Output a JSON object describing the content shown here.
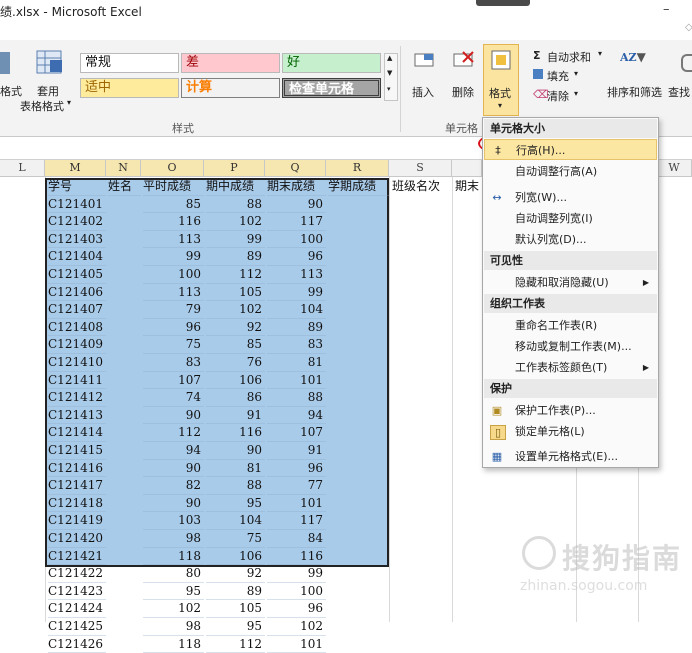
{
  "titlebar": {
    "title": "绩.xlsx - Microsoft Excel",
    "minimize_glyph": "–",
    "help_glyph": "⌂"
  },
  "ribbon": {
    "left_partial_label": "格式",
    "table_format_label1": "套用",
    "table_format_label2": "表格格式",
    "styles": {
      "normal": "常规",
      "bad": "差",
      "good": "好",
      "neutral": "适中",
      "calc": "计算",
      "check": "检查单元格",
      "group_label": "样式"
    },
    "cells": {
      "insert": "插入",
      "delete": "删除",
      "format": "格式",
      "group_label": "单元格"
    },
    "editing": {
      "autosum": "自动求和",
      "fill": "填充",
      "clear": "清除",
      "sort_filter": "排序和筛选",
      "find": "查找"
    },
    "colors": {
      "bad_bg": "#ffc7ce",
      "good_bg": "#c6efce",
      "neutral_bg": "#ffeb9c",
      "check_bg": "#a5a5a5"
    }
  },
  "columns": [
    "L",
    "M",
    "N",
    "O",
    "P",
    "Q",
    "R",
    "S",
    "W"
  ],
  "sheet": {
    "headers": [
      "学号",
      "姓名",
      "平时成绩",
      "期中成绩",
      "期末成绩",
      "学期成绩",
      "班级名次",
      "期末"
    ],
    "rows": [
      {
        "id": "C121401",
        "usual": "85",
        "mid": "88",
        "final": "90"
      },
      {
        "id": "C121402",
        "usual": "116",
        "mid": "102",
        "final": "117"
      },
      {
        "id": "C121403",
        "usual": "113",
        "mid": "99",
        "final": "100"
      },
      {
        "id": "C121404",
        "usual": "99",
        "mid": "89",
        "final": "96"
      },
      {
        "id": "C121405",
        "usual": "100",
        "mid": "112",
        "final": "113"
      },
      {
        "id": "C121406",
        "usual": "113",
        "mid": "105",
        "final": "99"
      },
      {
        "id": "C121407",
        "usual": "79",
        "mid": "102",
        "final": "104"
      },
      {
        "id": "C121408",
        "usual": "96",
        "mid": "92",
        "final": "89"
      },
      {
        "id": "C121409",
        "usual": "75",
        "mid": "85",
        "final": "83"
      },
      {
        "id": "C121410",
        "usual": "83",
        "mid": "76",
        "final": "81"
      },
      {
        "id": "C121411",
        "usual": "107",
        "mid": "106",
        "final": "101"
      },
      {
        "id": "C121412",
        "usual": "74",
        "mid": "86",
        "final": "88"
      },
      {
        "id": "C121413",
        "usual": "90",
        "mid": "91",
        "final": "94"
      },
      {
        "id": "C121414",
        "usual": "112",
        "mid": "116",
        "final": "107"
      },
      {
        "id": "C121415",
        "usual": "94",
        "mid": "90",
        "final": "91"
      },
      {
        "id": "C121416",
        "usual": "90",
        "mid": "81",
        "final": "96"
      },
      {
        "id": "C121417",
        "usual": "82",
        "mid": "88",
        "final": "77"
      },
      {
        "id": "C121418",
        "usual": "90",
        "mid": "95",
        "final": "101"
      },
      {
        "id": "C121419",
        "usual": "103",
        "mid": "104",
        "final": "117"
      },
      {
        "id": "C121420",
        "usual": "98",
        "mid": "75",
        "final": "84"
      },
      {
        "id": "C121421",
        "usual": "118",
        "mid": "106",
        "final": "116"
      },
      {
        "id": "C121422",
        "usual": "80",
        "mid": "92",
        "final": "99"
      },
      {
        "id": "C121423",
        "usual": "95",
        "mid": "89",
        "final": "100"
      },
      {
        "id": "C121424",
        "usual": "102",
        "mid": "105",
        "final": "96"
      },
      {
        "id": "C121425",
        "usual": "98",
        "mid": "95",
        "final": "102"
      },
      {
        "id": "C121426",
        "usual": "118",
        "mid": "112",
        "final": "101"
      }
    ]
  },
  "format_menu": {
    "cell_size_header": "单元格大小",
    "row_height": "行高(H)...",
    "autofit_row": "自动调整行高(A)",
    "col_width": "列宽(W)...",
    "autofit_col": "自动调整列宽(I)",
    "default_width": "默认列宽(D)...",
    "visibility_header": "可见性",
    "hide_unhide": "隐藏和取消隐藏(U)",
    "organize_header": "组织工作表",
    "rename": "重命名工作表(R)",
    "move_copy": "移动或复制工作表(M)...",
    "tab_color": "工作表标签颜色(T)",
    "protect_header": "保护",
    "protect_sheet": "保护工作表(P)...",
    "lock_cell": "锁定单元格(L)",
    "format_cells": "设置单元格格式(E)..."
  },
  "watermark": {
    "text": "搜狗指南",
    "url": "zhinan.sogou.com"
  }
}
